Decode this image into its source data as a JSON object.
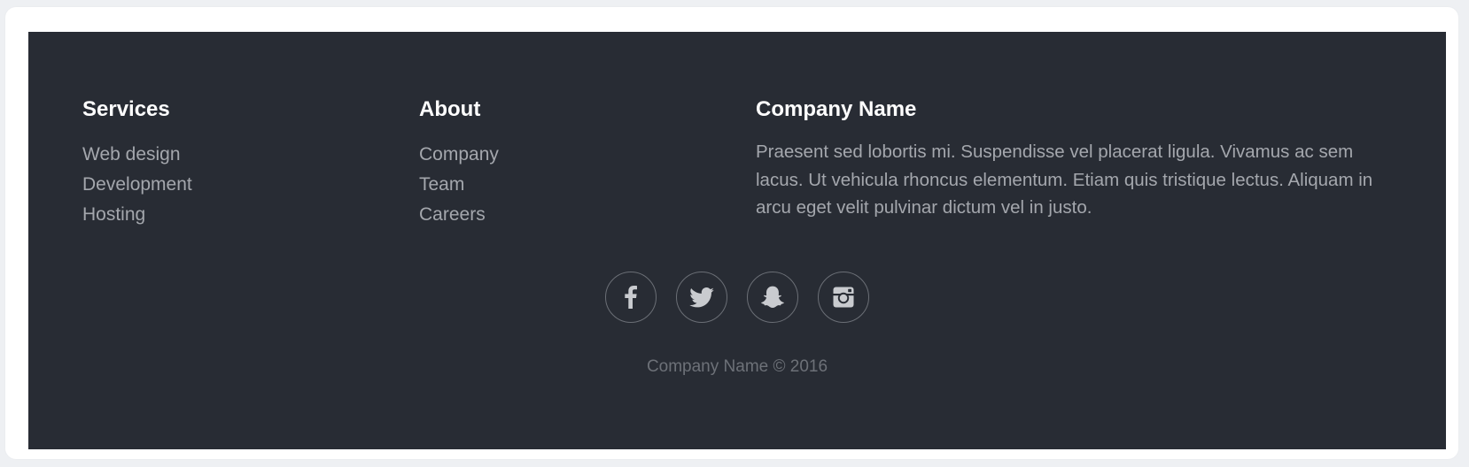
{
  "colors": {
    "footer_background": "#282c34",
    "heading": "#ffffff",
    "link": "#a4a7ad",
    "copyright": "#6d7178",
    "social_border": "#6b6f76"
  },
  "footer": {
    "services": {
      "title": "Services",
      "items": [
        "Web design",
        "Development",
        "Hosting"
      ]
    },
    "about": {
      "title": "About",
      "items": [
        "Company",
        "Team",
        "Careers"
      ]
    },
    "company": {
      "title": "Company Name",
      "description": "Praesent sed lobortis mi. Suspendisse vel placerat ligula. Vivamus ac sem lacus. Ut vehicula rhoncus elementum. Etiam quis tristique lectus. Aliquam in arcu eget velit pulvinar dictum vel in justo."
    },
    "social": [
      {
        "icon": "facebook-icon"
      },
      {
        "icon": "twitter-icon"
      },
      {
        "icon": "snapchat-icon"
      },
      {
        "icon": "instagram-icon"
      }
    ],
    "copyright": "Company Name © 2016"
  }
}
